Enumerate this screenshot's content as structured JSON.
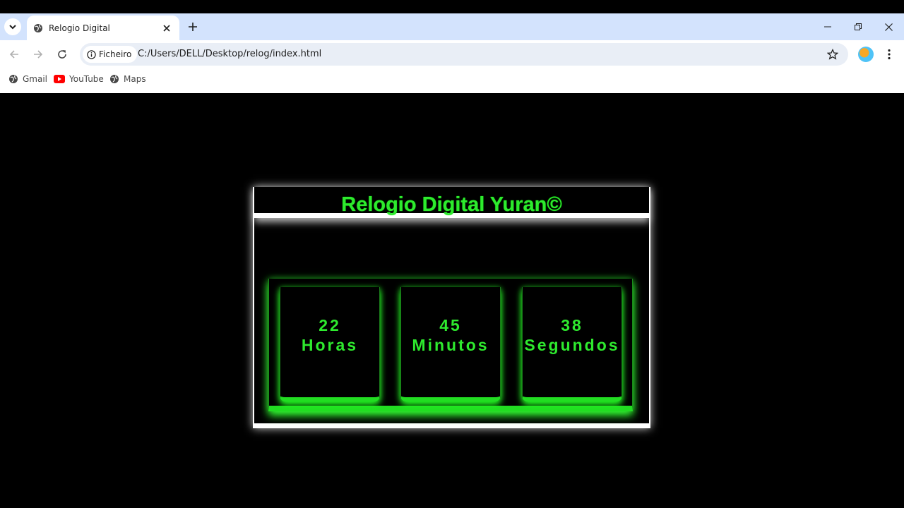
{
  "browser": {
    "tab_title": "Relogio Digital",
    "chip_label": "Ficheiro",
    "url": "C:/Users/DELL/Desktop/relog/index.html",
    "bookmarks": [
      {
        "label": "Gmail",
        "icon": "globe-icon"
      },
      {
        "label": "YouTube",
        "icon": "youtube-icon"
      },
      {
        "label": "Maps",
        "icon": "globe-icon"
      }
    ]
  },
  "clock": {
    "title": "Relogio Digital Yuran©",
    "units": [
      {
        "value": "22",
        "label": "Horas"
      },
      {
        "value": "45",
        "label": "Minutos"
      },
      {
        "value": "38",
        "label": "Segundos"
      }
    ]
  },
  "colors": {
    "accent_green": "#2eea2e",
    "tabstrip": "#d3e3fd"
  }
}
